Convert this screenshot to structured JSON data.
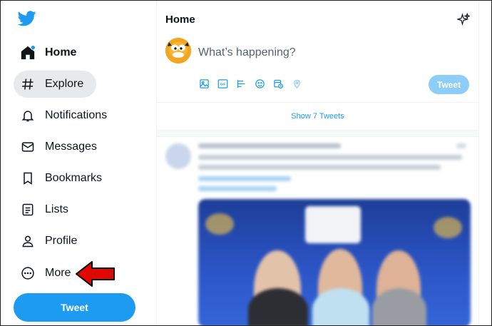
{
  "sidebar": {
    "items": [
      {
        "label": "Home"
      },
      {
        "label": "Explore"
      },
      {
        "label": "Notifications"
      },
      {
        "label": "Messages"
      },
      {
        "label": "Bookmarks"
      },
      {
        "label": "Lists"
      },
      {
        "label": "Profile"
      },
      {
        "label": "More"
      }
    ],
    "tweet_button": "Tweet"
  },
  "main": {
    "header_title": "Home",
    "compose_placeholder": "What’s happening?",
    "compose_tweet_button": "Tweet",
    "show_tweets": "Show 7 Tweets"
  },
  "colors": {
    "brand": "#1d9bf0",
    "arrow": "#e10600",
    "compose_button_disabled": "#8ecdf8"
  },
  "icons": [
    "twitter-bird-icon",
    "home-icon",
    "hashtag-icon",
    "bell-icon",
    "envelope-icon",
    "bookmark-icon",
    "list-icon",
    "person-icon",
    "more-circle-icon",
    "sparkle-icon",
    "image-icon",
    "gif-icon",
    "poll-icon",
    "emoji-icon",
    "schedule-icon",
    "location-icon"
  ]
}
